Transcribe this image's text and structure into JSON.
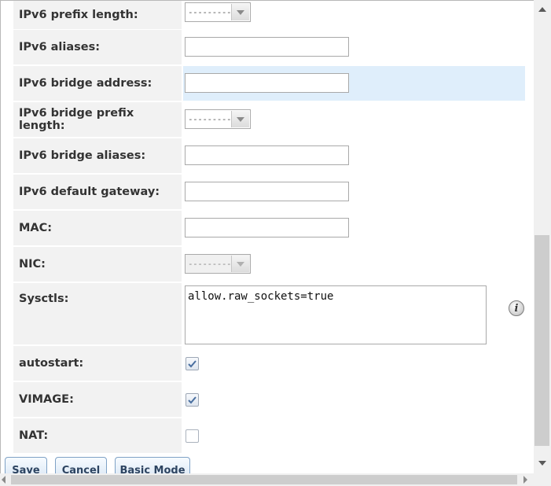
{
  "form": {
    "ipv6_prefix_length": {
      "label": "IPv6 prefix length:",
      "selected": "---------"
    },
    "ipv6_aliases": {
      "label": "IPv6 aliases:",
      "value": ""
    },
    "ipv6_bridge_address": {
      "label": "IPv6 bridge address:",
      "value": ""
    },
    "ipv6_bridge_prefix_length": {
      "label": "IPv6 bridge prefix length:",
      "selected": "---------"
    },
    "ipv6_bridge_aliases": {
      "label": "IPv6 bridge aliases:",
      "value": ""
    },
    "ipv6_default_gateway": {
      "label": "IPv6 default gateway:",
      "value": ""
    },
    "mac": {
      "label": "MAC:",
      "value": ""
    },
    "nic": {
      "label": "NIC:",
      "selected": "---------",
      "disabled": true
    },
    "sysctls": {
      "label": "Sysctls:",
      "value": "allow.raw_sockets=true",
      "help_icon": "info-icon"
    },
    "autostart": {
      "label": "autostart:",
      "checked": true
    },
    "vimage": {
      "label": "VIMAGE:",
      "checked": true
    },
    "nat": {
      "label": "NAT:",
      "checked": false
    }
  },
  "buttons": {
    "save": "Save",
    "cancel": "Cancel",
    "basic_mode": "Basic Mode"
  },
  "colors": {
    "highlight_row": "#dfeefb",
    "label_bg": "#f2f2f2",
    "button_border": "#7fa2c6"
  }
}
